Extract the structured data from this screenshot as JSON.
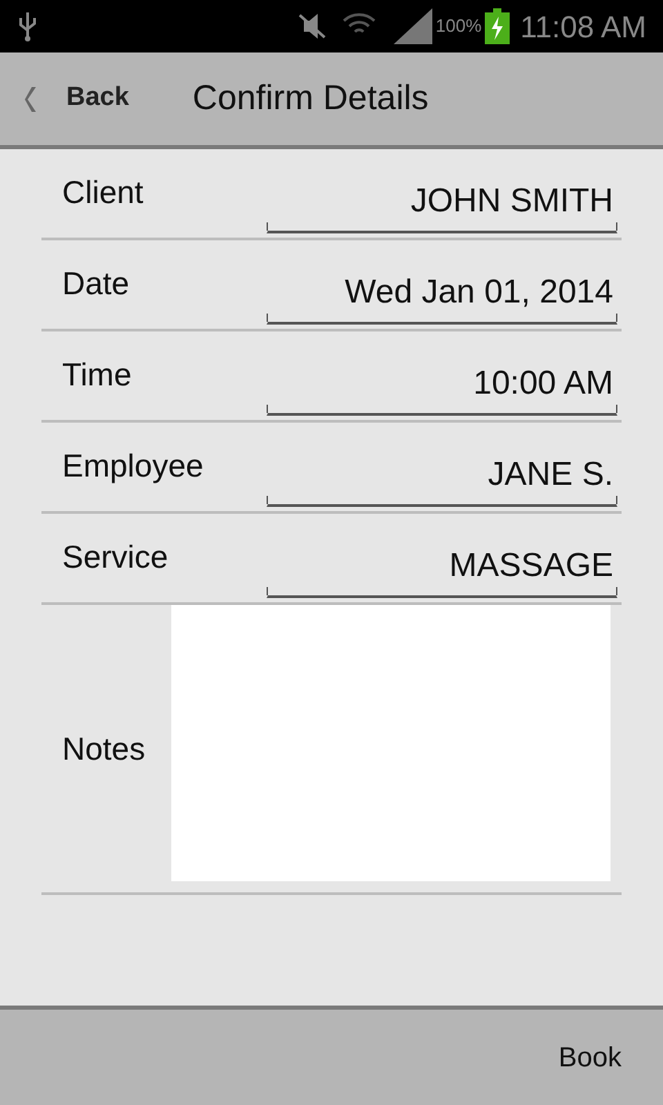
{
  "status_bar": {
    "battery": "100%",
    "time": "11:08 AM"
  },
  "header": {
    "back": "Back",
    "title": "Confirm Details"
  },
  "fields": [
    {
      "kind": "text",
      "label": "Client",
      "value": "JOHN SMITH"
    },
    {
      "kind": "text",
      "label": "Date",
      "value": "Wed Jan 01, 2014"
    },
    {
      "kind": "text",
      "label": "Time",
      "value": "10:00 AM"
    },
    {
      "kind": "text",
      "label": "Employee",
      "value": "JANE S."
    },
    {
      "kind": "text",
      "label": "Service",
      "value": "MASSAGE"
    },
    {
      "kind": "notes",
      "label": "Notes"
    }
  ],
  "footer": {
    "button": "Book"
  }
}
